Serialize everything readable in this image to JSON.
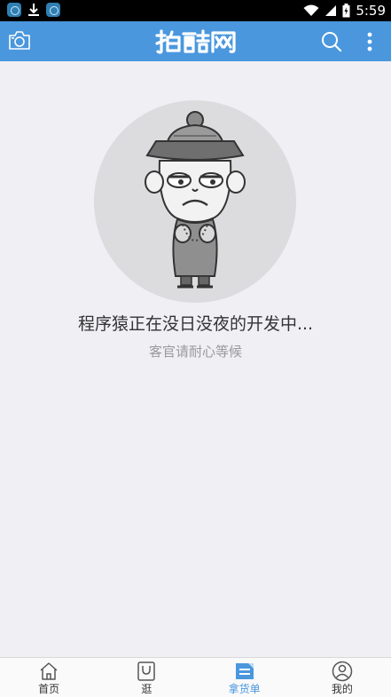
{
  "status_bar": {
    "time": "5:59",
    "icons": [
      "app-icon",
      "download-icon",
      "app-icon",
      "wifi-icon",
      "signal-icon",
      "battery-icon"
    ]
  },
  "app_bar": {
    "logo_text": "拍酷网",
    "icons": [
      "camera-icon",
      "search-icon",
      "more-icon"
    ],
    "background": "#4a97de"
  },
  "empty_state": {
    "title": "程序猿正在没日没夜的开发中...",
    "subtitle": "客官请耐心等候"
  },
  "tab_bar": {
    "items": [
      {
        "label": "首页",
        "icon": "home-icon",
        "active": false
      },
      {
        "label": "逛",
        "icon": "bag-icon",
        "active": false
      },
      {
        "label": "拿货单",
        "icon": "list-icon",
        "active": true
      },
      {
        "label": "我的",
        "icon": "user-icon",
        "active": false
      }
    ],
    "active_color": "#4a97de"
  }
}
